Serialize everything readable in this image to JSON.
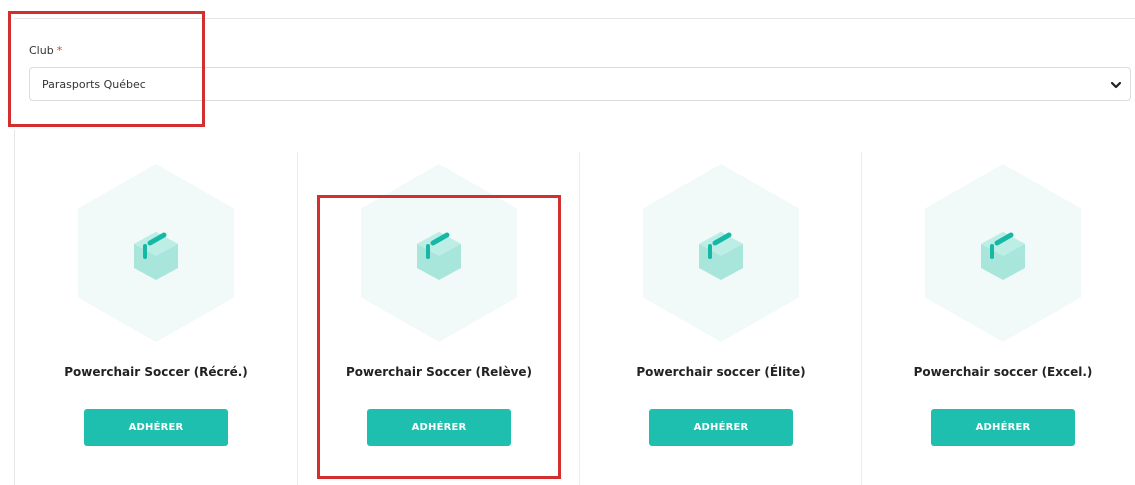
{
  "form": {
    "club_label": "Club",
    "required_marker": "*",
    "club_selected": "Parasports Québec"
  },
  "programs": [
    {
      "name": "Powerchair Soccer (Récré.)",
      "button_label": "ADHÉRER"
    },
    {
      "name": "Powerchair Soccer (Relève)",
      "button_label": "ADHÉRER"
    },
    {
      "name": "Powerchair soccer (Élite)",
      "button_label": "ADHÉRER"
    },
    {
      "name": "Powerchair soccer (Excel.)",
      "button_label": "ADHÉRER"
    }
  ],
  "colors": {
    "accent": "#1ebfae",
    "hex_bg": "#f1faf8",
    "cube_light": "#a8e6dc",
    "cube_dark": "#16b7a5",
    "annotation": "#d32f2f"
  },
  "icons": {
    "select_toggle": "chevron-down-icon",
    "program_placeholder": "package-icon"
  }
}
